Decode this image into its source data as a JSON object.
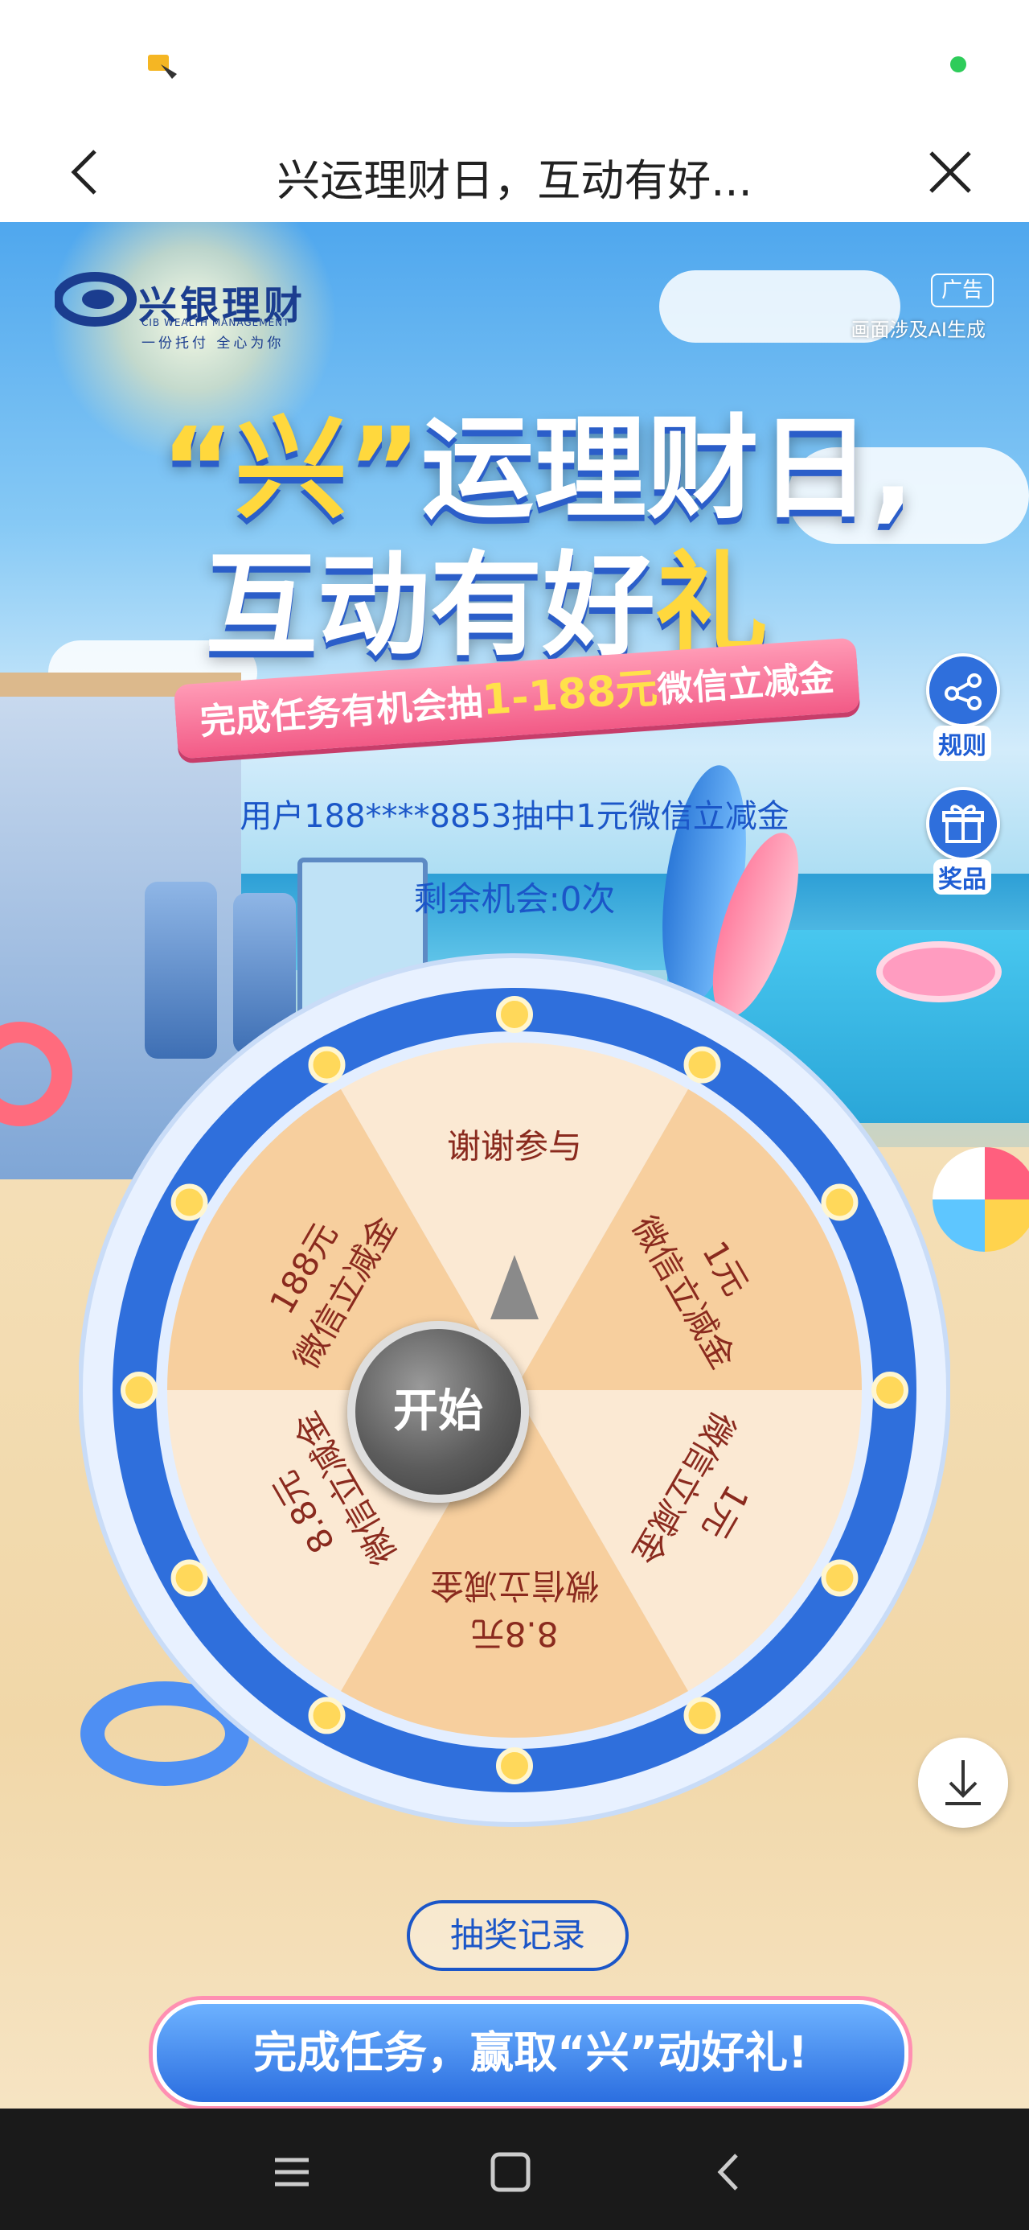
{
  "nav": {
    "title": "兴运理财日，互动有好..."
  },
  "brand": {
    "name": "兴银理财",
    "english": "CIB WEALTH MANAGEMENT",
    "slogan": "一份托付  全心为你"
  },
  "ad": {
    "badge": "广告",
    "note": "画面涉及AI生成"
  },
  "hero": {
    "headline_quote_open": "“",
    "headline_highlight": "兴",
    "headline_quote_close": "”",
    "headline_rest": "运理财日,",
    "headline2_text": "互动有好",
    "headline2_highlight": "礼",
    "ribbon_prefix": "完成任务有机会抽",
    "ribbon_amount": "1-188元",
    "ribbon_suffix": "微信立减金"
  },
  "side_buttons": {
    "rules": "规则",
    "prizes": "奖品"
  },
  "ticker": "用户188****8853抽中1元微信立减金",
  "chances": "剩余机会:0次",
  "wheel": {
    "start_label": "开始",
    "segments": [
      {
        "line1": "谢谢参与",
        "line2": ""
      },
      {
        "line1": "1元",
        "line2": "微信立减金"
      },
      {
        "line1": "1元",
        "line2": "微信立减金"
      },
      {
        "line1": "8.8元",
        "line2": "微信立减金"
      },
      {
        "line1": "8.8元",
        "line2": "微信立减金"
      },
      {
        "line1": "188元",
        "line2": "微信立减金"
      }
    ],
    "colors": {
      "light": "#fbe9d3",
      "dark": "#f7cf9e",
      "text": "#8a2a1e",
      "rim": "#2f6fdc"
    }
  },
  "record_button": "抽奖记录",
  "task_banner": "完成任务，赢取“兴”动好礼!",
  "icons": {
    "back": "chevron-left-icon",
    "close": "close-icon",
    "download": "download-icon",
    "menu": "menu-icon",
    "home": "home-icon",
    "sys_back": "back-icon"
  }
}
